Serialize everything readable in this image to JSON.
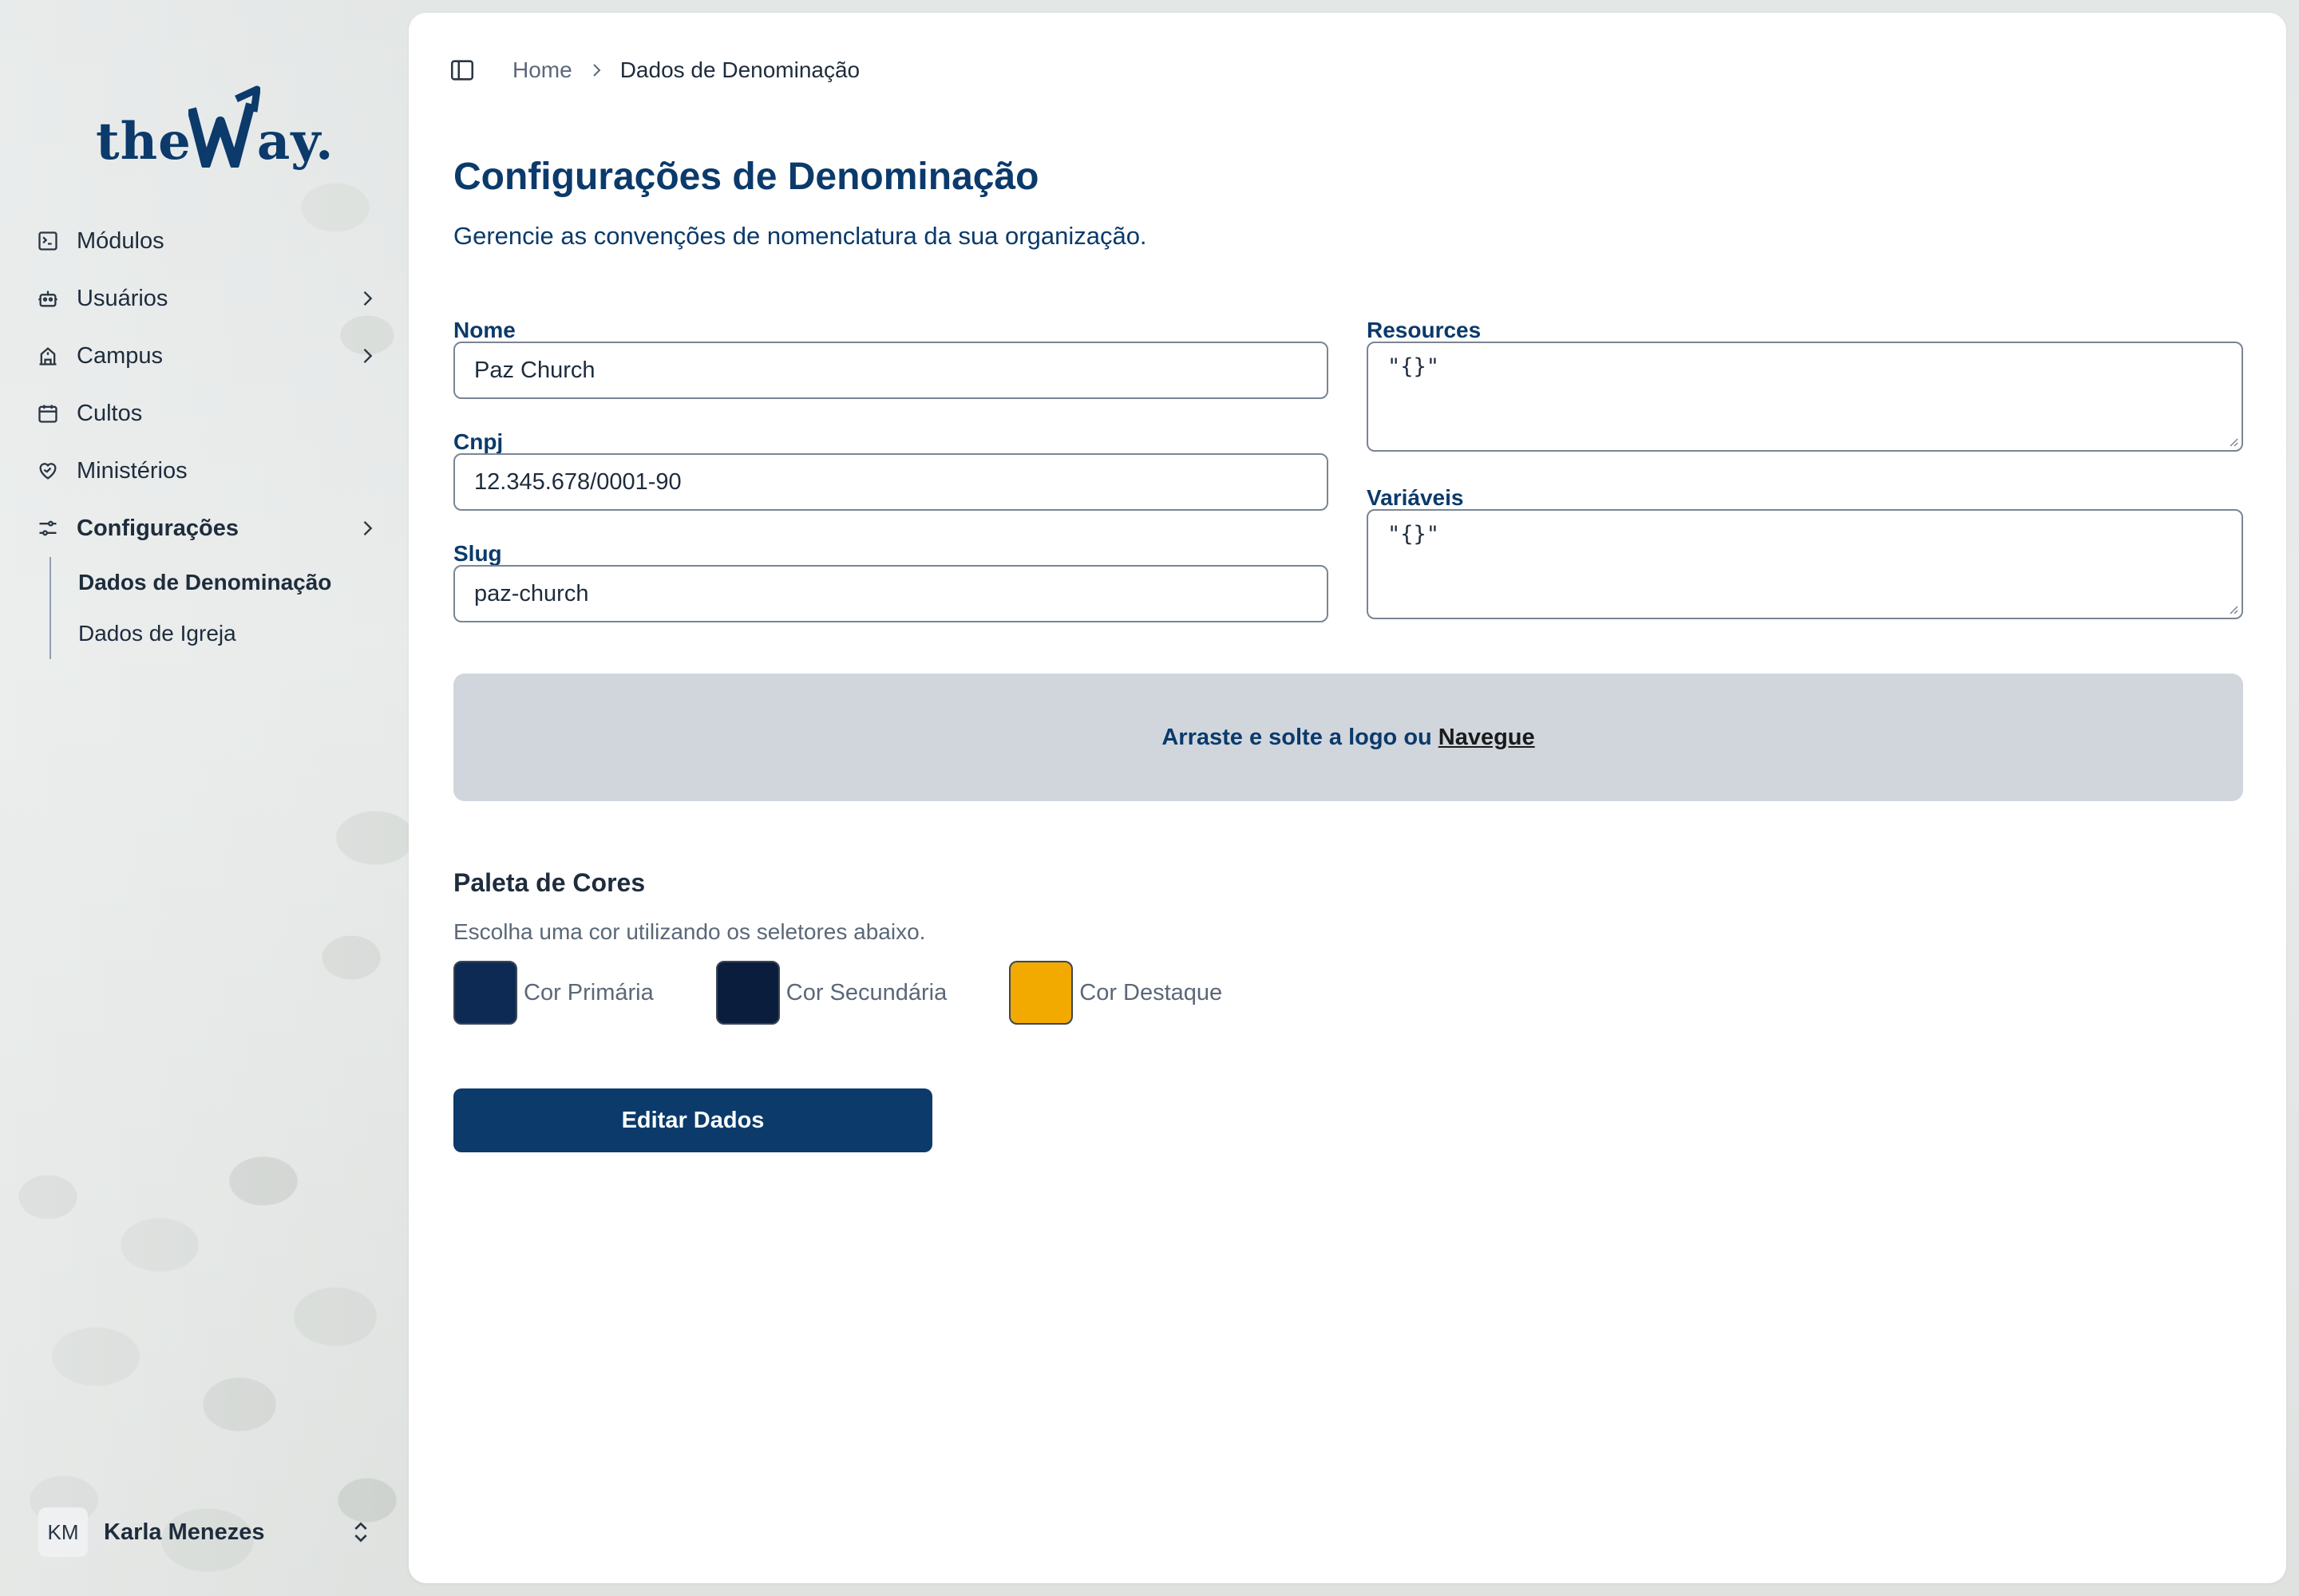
{
  "app": {
    "logo_text_left": "the",
    "logo_text_right": "ay.",
    "brand_color": "#0b3a6b"
  },
  "sidebar": {
    "items": [
      {
        "label": "Módulos",
        "icon": "modules-icon",
        "has_chevron": false
      },
      {
        "label": "Usuários",
        "icon": "users-icon",
        "has_chevron": true
      },
      {
        "label": "Campus",
        "icon": "campus-icon",
        "has_chevron": true
      },
      {
        "label": "Cultos",
        "icon": "calendar-icon",
        "has_chevron": false
      },
      {
        "label": "Ministérios",
        "icon": "heart-handshake-icon",
        "has_chevron": false
      },
      {
        "label": "Configurações",
        "icon": "settings-sliders-icon",
        "has_chevron": true,
        "expanded": true
      }
    ],
    "subitems": [
      {
        "label": "Dados de Denominação",
        "active": true
      },
      {
        "label": "Dados de Igreja",
        "active": false
      }
    ],
    "user": {
      "initials": "KM",
      "name": "Karla Menezes"
    }
  },
  "breadcrumb": {
    "home": "Home",
    "current": "Dados de Denominação"
  },
  "page": {
    "title": "Configurações de Denominação",
    "subtitle": "Gerencie as convenções de nomenclatura da sua organização."
  },
  "form": {
    "nome": {
      "label": "Nome",
      "value": "Paz Church"
    },
    "cnpj": {
      "label": "Cnpj",
      "value": "12.345.678/0001-90"
    },
    "slug": {
      "label": "Slug",
      "value": "paz-church"
    },
    "resources": {
      "label": "Resources",
      "value": "\"{}\""
    },
    "variaveis": {
      "label": "Variáveis",
      "value": "\"{}\""
    }
  },
  "dropzone": {
    "text": "Arraste e solte a logo ou",
    "link": "Navegue"
  },
  "palette": {
    "title": "Paleta de Cores",
    "subtitle": "Escolha uma cor utilizando os seletores abaixo.",
    "colors": [
      {
        "label": "Cor Primária",
        "hex": "#0d2a55"
      },
      {
        "label": "Cor Secundária",
        "hex": "#0a1d3d"
      },
      {
        "label": "Cor Destaque",
        "hex": "#f2a900"
      }
    ]
  },
  "actions": {
    "edit_label": "Editar Dados"
  }
}
